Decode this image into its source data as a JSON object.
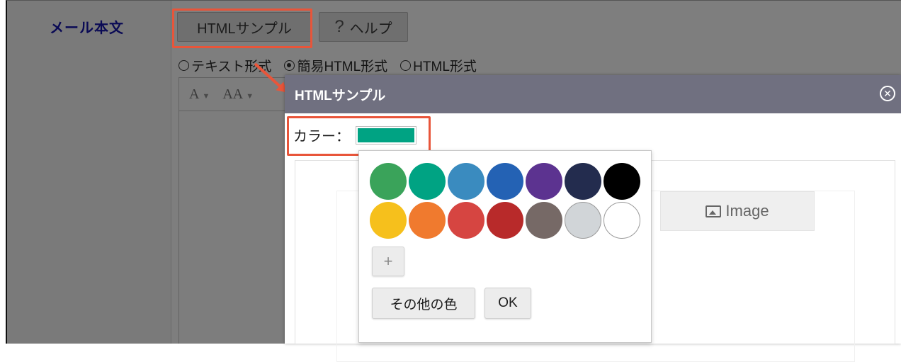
{
  "form": {
    "label": "メール本文"
  },
  "toolbar_top": {
    "html_sample_label": "HTMLサンプル",
    "help_icon": "?",
    "help_label": "ヘルプ"
  },
  "format_options": [
    {
      "label": "テキスト形式",
      "selected": false
    },
    {
      "label": "簡易HTML形式",
      "selected": true
    },
    {
      "label": "HTML形式",
      "selected": false
    }
  ],
  "editor_toolbar": {
    "font_icon": "A",
    "font_size_icon": "AA",
    "caret": "▼"
  },
  "dialog": {
    "title": "HTMLサンプル",
    "close_icon": "✕",
    "color_label": "カラー：",
    "selected_color": "#00a383",
    "image_placeholder": "Image"
  },
  "color_picker": {
    "swatches": [
      "#3aa35a",
      "#00a383",
      "#3a8bbf",
      "#2462b4",
      "#5c3390",
      "#232c4e",
      "#000000",
      "#f6c01c",
      "#f07a2e",
      "#d64541",
      "#b82a2a",
      "#766966",
      "#d1d5d8",
      "#ffffff"
    ],
    "add_icon": "+",
    "more_colors_label": "その他の色",
    "ok_label": "OK"
  },
  "colors": {
    "highlight": "#e8553a"
  }
}
